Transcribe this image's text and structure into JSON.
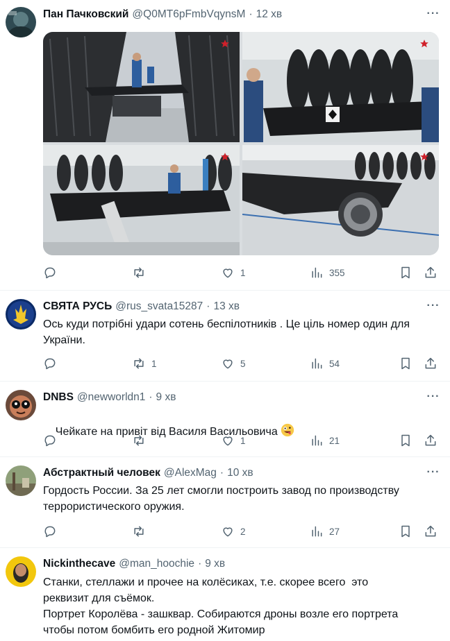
{
  "tweets": [
    {
      "name": "Пан Пачковский",
      "handle": "@Q0MT6pFmbVqynsM",
      "time": "12 хв",
      "text": "",
      "reply_count": "",
      "retweet_count": "",
      "like_count": "1",
      "view_count": "355"
    },
    {
      "name": "СВЯТА РУСЬ",
      "handle": "@rus_svata15287",
      "time": "13 хв",
      "text": "Ось куди потрібні удари сотень беспілотників . Це ціль номер один для\nУкраїни.",
      "reply_count": "",
      "retweet_count": "1",
      "like_count": "5",
      "view_count": "54"
    },
    {
      "name": "DNBS",
      "handle": "@newworldn1",
      "time": "9 хв",
      "text": "Чейкате на привіт від Василя Васильовича",
      "emoji": "zany-face",
      "reply_count": "",
      "retweet_count": "",
      "like_count": "1",
      "view_count": "21"
    },
    {
      "name": "Абстрактный человек",
      "handle": "@AlexMag",
      "time": "10 хв",
      "text": "Гордость России. За 25 лет смогли построить завод по производству\nтеррористического оружия.",
      "reply_count": "",
      "retweet_count": "",
      "like_count": "2",
      "view_count": "27"
    },
    {
      "name": "Nickinthecave",
      "handle": "@man_hoochie",
      "time": "9 хв",
      "text": "Станки, стеллажи и прочее на колёсиках, т.е. скорее всего  это\nреквизит для съёмок.\nПортрет Королёва - зашквар. Собираются дроны возле его портрета\nчтобы потом бомбить его родной Житомир"
    }
  ],
  "icons": {
    "reply": "reply-icon",
    "retweet": "retweet-icon",
    "like": "like-icon",
    "views": "views-icon",
    "bookmark": "bookmark-icon",
    "share": "share-icon",
    "more": "more-icon"
  },
  "colors": {
    "text": "#0f1419",
    "secondary": "#536471",
    "separator": "#eff3f4",
    "watermark_star": "#d0202a"
  }
}
